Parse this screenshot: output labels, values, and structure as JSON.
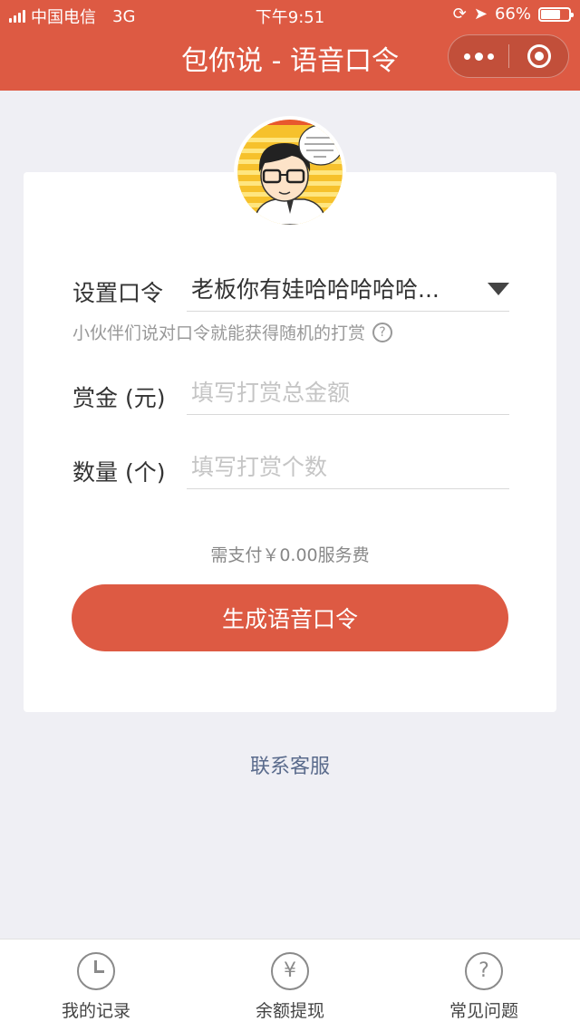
{
  "status_bar": {
    "carrier": "中国电信",
    "network": "3G",
    "time": "下午9:51",
    "battery": "66%",
    "battery_level": 0.66
  },
  "nav": {
    "title": "包你说 - 语音口令"
  },
  "form": {
    "command_label": "设置口令",
    "command_value": "老板你有娃哈哈哈哈哈...",
    "hint": "小伙伴们说对口令就能获得随机的打赏",
    "amount_label": "赏金 (元)",
    "amount_placeholder": "填写打赏总金额",
    "count_label": "数量 (个)",
    "count_placeholder": "填写打赏个数"
  },
  "fee_text": "需支付￥0.00服务费",
  "submit_label": "生成语音口令",
  "contact_label": "联系客服",
  "tabs": [
    {
      "label": "我的记录",
      "icon": "clock-icon"
    },
    {
      "label": "余额提现",
      "icon": "yen-icon"
    },
    {
      "label": "常见问题",
      "icon": "question-icon"
    }
  ],
  "colors": {
    "brand": "#dd5a43",
    "background": "#efeff4",
    "link": "#5a6b8c"
  }
}
